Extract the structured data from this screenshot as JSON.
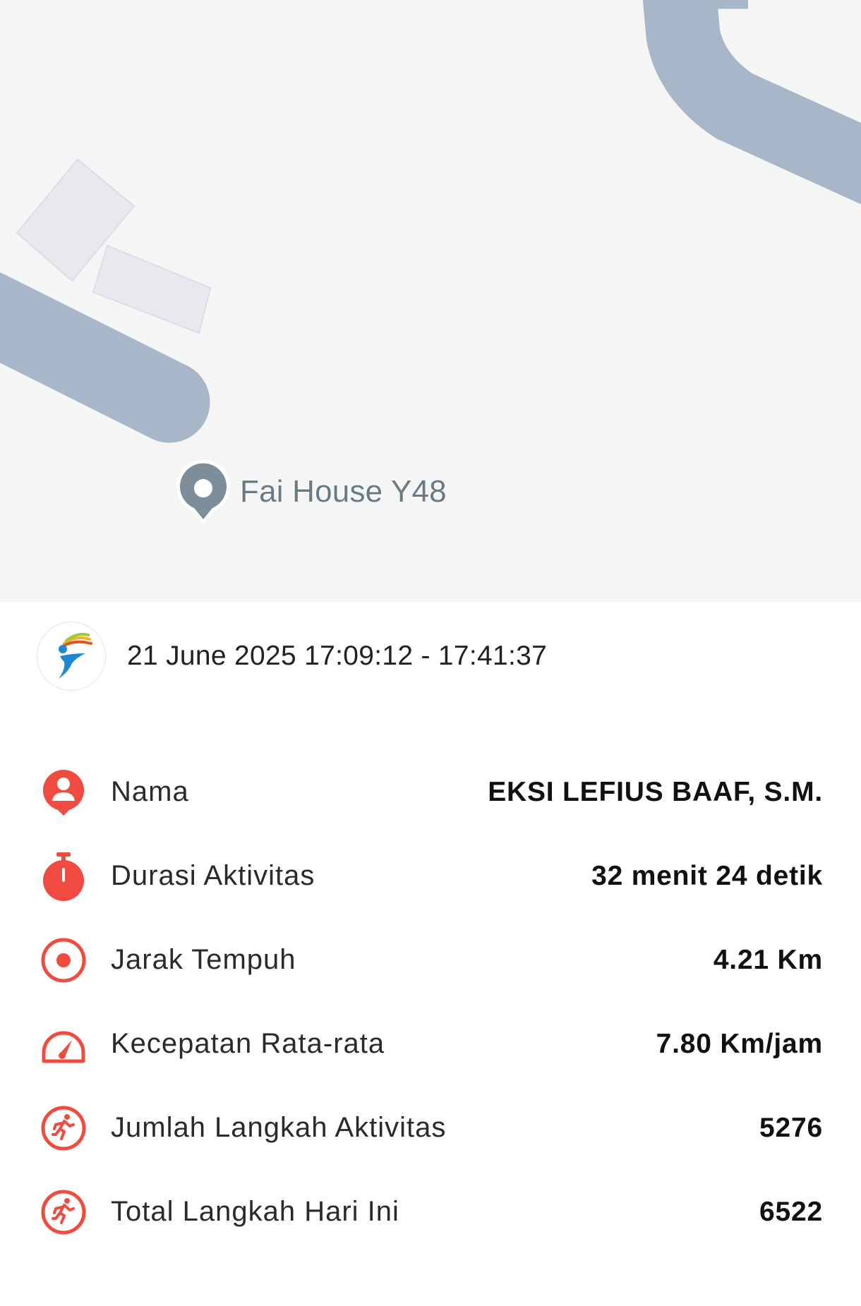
{
  "map": {
    "place_label": "Fai House Y48",
    "colors": {
      "background": "#f5f5f5",
      "road": "#a8b7c8",
      "building": "#e8e9ee",
      "pin": "#7d8d99"
    }
  },
  "session": {
    "logo_icon": "runner-logo-icon",
    "datetime_range": "21 June 2025 17:09:12 - 17:41:37"
  },
  "stats": {
    "accent_color": "#ef4b40",
    "items": [
      {
        "icon": "user-pin-icon",
        "label": "Nama",
        "value": "EKSI LEFIUS BAAF, S.M."
      },
      {
        "icon": "stopwatch-icon",
        "label": "Durasi Aktivitas",
        "value": "32 menit 24 detik"
      },
      {
        "icon": "target-icon",
        "label": "Jarak Tempuh",
        "value": "4.21 Km"
      },
      {
        "icon": "speedometer-icon",
        "label": "Kecepatan Rata-rata",
        "value": "7.80 Km/jam"
      },
      {
        "icon": "running-person-icon",
        "label": "Jumlah Langkah Aktivitas",
        "value": "5276"
      },
      {
        "icon": "running-person-icon",
        "label": "Total Langkah Hari Ini",
        "value": "6522"
      }
    ]
  }
}
